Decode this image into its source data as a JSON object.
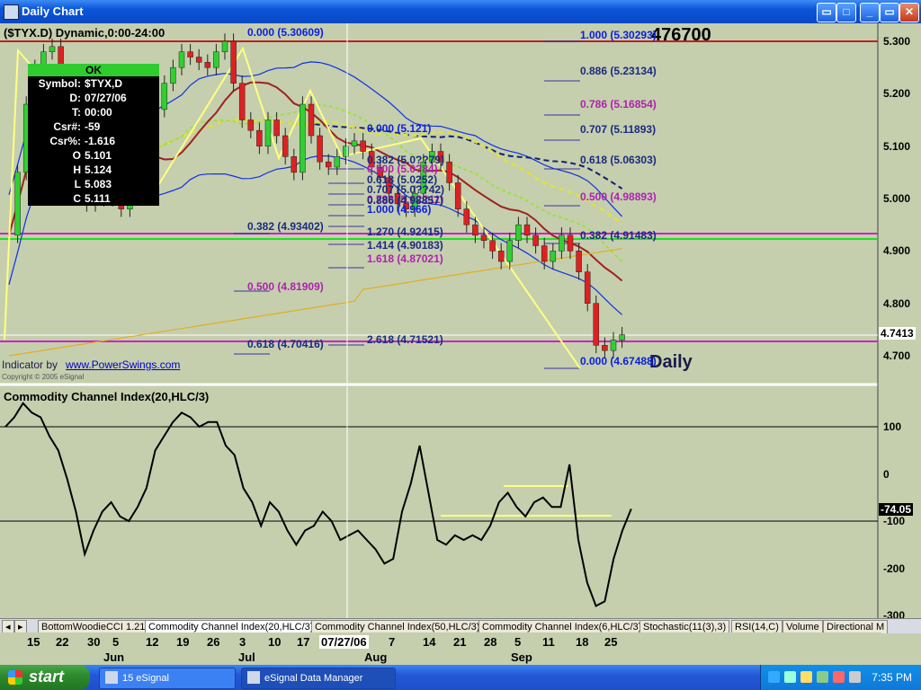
{
  "window": {
    "title": "Daily Chart",
    "min_label": "_",
    "max_label": "□",
    "close_label": "✕",
    "restore_label": "▭"
  },
  "chart": {
    "symbol_header": "($TYX.D) Dynamic,0:00-24:00",
    "current_price_label": "4.7413",
    "big_label": "476700",
    "daily_label": "Daily",
    "indicator_text": "Indicator by",
    "indicator_link": "www.PowerSwings.com",
    "copyright": "Copyright © 2005 eSignal",
    "price_axis": [
      "5.300",
      "5.200",
      "5.100",
      "5.000",
      "4.900",
      "4.800",
      "4.700"
    ],
    "fib_labels": [
      {
        "text": "0.000 (5.30609)",
        "color": "#0a1ee0"
      },
      {
        "text": "1.000 (5.30293)",
        "color": "#0a1ee0"
      },
      {
        "text": "0.886 (5.23134)",
        "color": "#1a2a80"
      },
      {
        "text": "0.786 (5.16854)",
        "color": "#b020b0"
      },
      {
        "text": "0.707 (5.11893)",
        "color": "#1a2a80"
      },
      {
        "text": "0.000 (5.121)",
        "color": "#0a1ee0"
      },
      {
        "text": "0.618 (5.06303)",
        "color": "#1a2a80"
      },
      {
        "text": "0.500 (4.98893)",
        "color": "#b020b0"
      },
      {
        "text": "0.382 (4.91483)",
        "color": "#1a2a80"
      },
      {
        "text": "0.382 (5.0??79)",
        "color": "#1a2a80"
      },
      {
        "text": "0.500 (5.0?84)",
        "color": "#b020b0"
      },
      {
        "text": "0.618 (5.0252)",
        "color": "#1a2a80"
      },
      {
        "text": "0.707 (5.0??42)",
        "color": "#1a2a80"
      },
      {
        "text": "0.786 (5.0??11)",
        "color": "#b020b0"
      },
      {
        "text": "0.886 (4.98857)",
        "color": "#1a2a80"
      },
      {
        "text": "1.000 (4.966)",
        "color": "#0a1ee0"
      },
      {
        "text": "0.382 (4.93402)",
        "color": "#1a2a80"
      },
      {
        "text": "1.270 (4.92415)",
        "color": "#1a2a80"
      },
      {
        "text": "1.414 (4.90183)",
        "color": "#1a2a80"
      },
      {
        "text": "1.618 (4.87021)",
        "color": "#b020b0"
      },
      {
        "text": "0.500 (4.81909)",
        "color": "#b020b0"
      },
      {
        "text": "0.618 (4.70416)",
        "color": "#1a2a80"
      },
      {
        "text": "2.618 (4.71521)",
        "color": "#1a2a80"
      },
      {
        "text": "0.000 (4.67488)",
        "color": "#0a1ee0"
      }
    ]
  },
  "cursor_box": {
    "ok": "OK",
    "rows": [
      {
        "k": "Symbol:",
        "v": "$TYX,D"
      },
      {
        "k": "D:",
        "v": "07/27/06"
      },
      {
        "k": "T:",
        "v": "00:00"
      },
      {
        "k": "Csr#:",
        "v": "-59"
      },
      {
        "k": "Csr%:",
        "v": "-1.616"
      },
      {
        "k": "O",
        "v": "5.101"
      },
      {
        "k": "H",
        "v": "5.124"
      },
      {
        "k": "L",
        "v": "5.083"
      },
      {
        "k": "C",
        "v": "5.111"
      }
    ]
  },
  "cci": {
    "title": "Commodity Channel Index(20,HLC/3)",
    "current_label": "-74.05",
    "axis": [
      "100",
      "0",
      "-100",
      "-200",
      "-300"
    ]
  },
  "tabs": [
    "BottomWoodieCCI 1.21",
    "Commodity Channel Index(20,HLC/3)",
    "Commodity Channel Index(50,HLC/3)",
    "Commodity Channel Index(6,HLC/3)",
    "Stochastic(11(3),3)",
    "RSI(14,C)",
    "Volume",
    "Directional M"
  ],
  "dates": {
    "days": [
      "15",
      "22",
      "30",
      "5",
      "12",
      "19",
      "26",
      "3",
      "10",
      "17",
      "07/27/06",
      "7",
      "14",
      "21",
      "28",
      "5",
      "11",
      "18",
      "25"
    ],
    "months": [
      "Jun",
      "Jul",
      "Aug",
      "Sep"
    ]
  },
  "taskbar": {
    "start": "start",
    "btn1": "15 eSignal",
    "btn2": "eSignal Data Manager",
    "clock": "7:35 PM"
  },
  "chart_data": {
    "type": "candlestick",
    "symbol": "$TYX",
    "price_axis_ticks": [
      5.3,
      5.2,
      5.1,
      5.0,
      4.9,
      4.8,
      4.7
    ],
    "last_price": 4.7413,
    "cursor_bar": {
      "date": "07/27/06",
      "open": 5.101,
      "high": 5.124,
      "low": 5.083,
      "close": 5.111
    },
    "cci_ticks": [
      100,
      0,
      -100,
      -200,
      -300
    ],
    "cci_last": -74.05,
    "closes": [
      4.93,
      5.05,
      5.18,
      5.25,
      5.28,
      5.29,
      5.24,
      5.12,
      5.03,
      4.99,
      5.0,
      5.05,
      5.0,
      4.98,
      5.02,
      5.05,
      5.1,
      5.17,
      5.22,
      5.25,
      5.28,
      5.27,
      5.26,
      5.25,
      5.28,
      5.3,
      5.22,
      5.15,
      5.13,
      5.1,
      5.15,
      5.12,
      5.08,
      5.05,
      5.18,
      5.12,
      5.07,
      5.06,
      5.08,
      5.1,
      5.11,
      5.09,
      5.06,
      5.04,
      5.01,
      4.99,
      4.98,
      5.01,
      5.07,
      5.09,
      5.07,
      5.03,
      4.98,
      4.95,
      4.93,
      4.92,
      4.9,
      4.88,
      4.92,
      4.95,
      4.93,
      4.91,
      4.88,
      4.9,
      4.93,
      4.9,
      4.86,
      4.8,
      4.72,
      4.71,
      4.73,
      4.74
    ],
    "cci_values": [
      100,
      120,
      150,
      130,
      120,
      80,
      50,
      -10,
      -80,
      -170,
      -120,
      -80,
      -60,
      -90,
      -100,
      -70,
      -30,
      50,
      80,
      110,
      130,
      120,
      100,
      110,
      110,
      60,
      40,
      -30,
      -60,
      -110,
      -60,
      -80,
      -120,
      -150,
      -120,
      -110,
      -80,
      -100,
      -140,
      -130,
      -120,
      -140,
      -160,
      -190,
      -180,
      -80,
      -20,
      60,
      -40,
      -140,
      -150,
      -130,
      -140,
      -130,
      -140,
      -110,
      -60,
      -40,
      -70,
      -90,
      -60,
      -50,
      -70,
      -70,
      20,
      -140,
      -230,
      -280,
      -270,
      -180,
      -120,
      -74
    ]
  }
}
